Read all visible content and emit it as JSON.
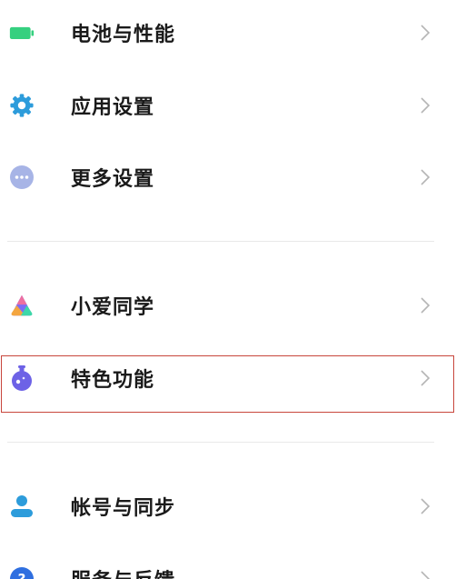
{
  "settings_list": {
    "items": [
      {
        "label": "电池与性能",
        "icon": "battery-icon",
        "color": "#35d07f"
      },
      {
        "label": "应用设置",
        "icon": "gear-icon",
        "color": "#2d9cdb"
      },
      {
        "label": "更多设置",
        "icon": "more-dots-icon",
        "color": "#a7b4e6"
      },
      {
        "label": "小爱同学",
        "icon": "xiaoai-assistant-icon",
        "color": "#7b6cf6"
      },
      {
        "label": "特色功能",
        "icon": "flask-icon",
        "color": "#6d62e6"
      },
      {
        "label": "帐号与同步",
        "icon": "account-icon",
        "color": "#2d9cdb"
      },
      {
        "label": "服务与反馈",
        "icon": "help-icon",
        "color": "#2f6fe0"
      }
    ]
  },
  "highlight_color": "#c8463c"
}
